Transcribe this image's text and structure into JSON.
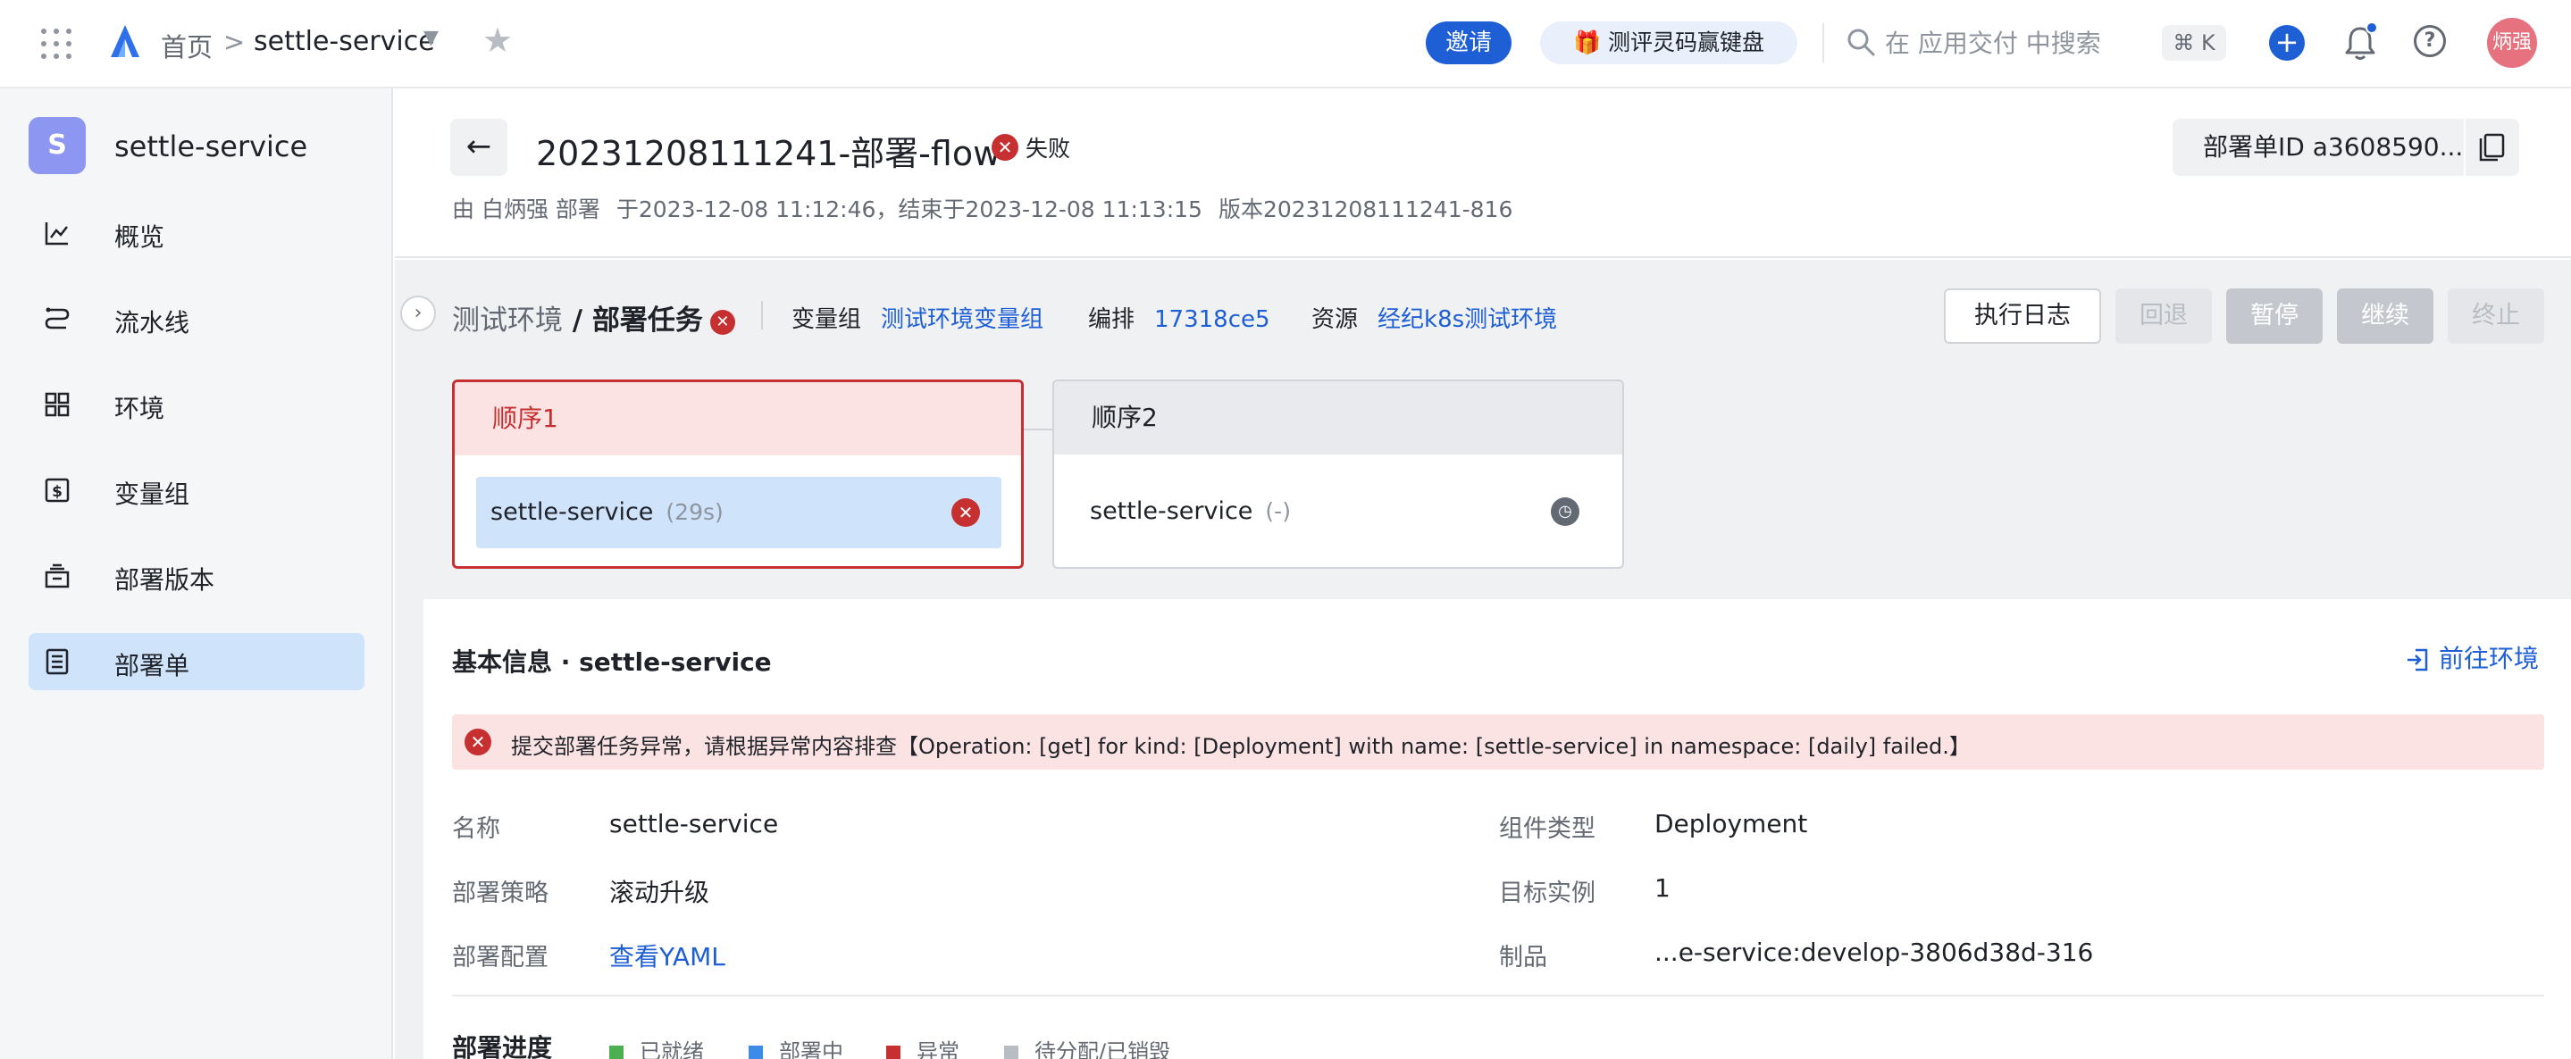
{
  "topbar": {
    "breadcrumb_home": "首页",
    "breadcrumb_sep": ">",
    "breadcrumb_app": "settle-service",
    "invite_label": "邀请",
    "promo_label": "🎁 测评灵码赢键盘",
    "search_placeholder": "在 应用交付 中搜索",
    "shortcut_label": "⌘ K",
    "add_label": "+",
    "help_label": "?",
    "avatar_text": "炳强",
    "colors": {
      "accent": "#1e5fd6",
      "avatar": "#e6717f"
    }
  },
  "sidebar": {
    "app_badge": "S",
    "app_name": "settle-service",
    "items": [
      {
        "label": "概览",
        "icon": "chart-line-icon",
        "active": false
      },
      {
        "label": "流水线",
        "icon": "pipeline-icon",
        "active": false
      },
      {
        "label": "环境",
        "icon": "grid-icon",
        "active": false
      },
      {
        "label": "变量组",
        "icon": "dollar-box-icon",
        "active": false
      },
      {
        "label": "部署版本",
        "icon": "archive-icon",
        "active": false
      },
      {
        "label": "部署单",
        "icon": "document-icon",
        "active": true
      }
    ]
  },
  "header": {
    "back_label": "←",
    "title": "20231208111241-部署-flow",
    "status": "失败",
    "meta_by": "由 白炳强 部署",
    "meta_time": "于2023-12-08 11:12:46，结束于2023-12-08 11:13:15",
    "meta_version": "版本20231208111241-816",
    "deploy_id_label": "部署单ID a3608590..."
  },
  "stage": {
    "collapse_label": "›",
    "env": "测试环境",
    "sep": " / ",
    "task": "部署任务",
    "var_group_key": "变量组",
    "var_group_value": "测试环境变量组",
    "orchestration_key": "编排",
    "orchestration_value": "17318ce5",
    "resource_key": "资源",
    "resource_value": "经纪k8s测试环境",
    "buttons": {
      "log": "执行日志",
      "rollback": "回退",
      "pause": "暂停",
      "resume": "继续",
      "stop": "终止"
    },
    "columns": [
      {
        "name": "顺序1",
        "state": "failed",
        "task": "settle-service",
        "duration": "(29s)"
      },
      {
        "name": "顺序2",
        "state": "pending",
        "task": "settle-service",
        "duration": "(-)"
      }
    ]
  },
  "detail": {
    "title": "基本信息 · settle-service",
    "goto_env": "前往环境",
    "alert": "提交部署任务异常，请根据异常内容排查【Operation: [get]  for kind: [Deployment]  with name: [settle-service]  in namespace: [daily]  failed.】",
    "fields": {
      "name_key": "名称",
      "name_value": "settle-service",
      "strategy_key": "部署策略",
      "strategy_value": "滚动升级",
      "config_key": "部署配置",
      "config_value": "查看YAML",
      "type_key": "组件类型",
      "type_value": "Deployment",
      "replicas_key": "目标实例",
      "replicas_value": "1",
      "artifact_key": "制品",
      "artifact_value": "...e-service:develop-3806d38d-316"
    },
    "progress_title": "部署进度",
    "legend": [
      {
        "label": "已就绪",
        "color": "#4caf50"
      },
      {
        "label": "部署中",
        "color": "#3d8be8"
      },
      {
        "label": "异常",
        "color": "#c73030"
      },
      {
        "label": "待分配/已销毁",
        "color": "#b8bdc4"
      }
    ]
  }
}
